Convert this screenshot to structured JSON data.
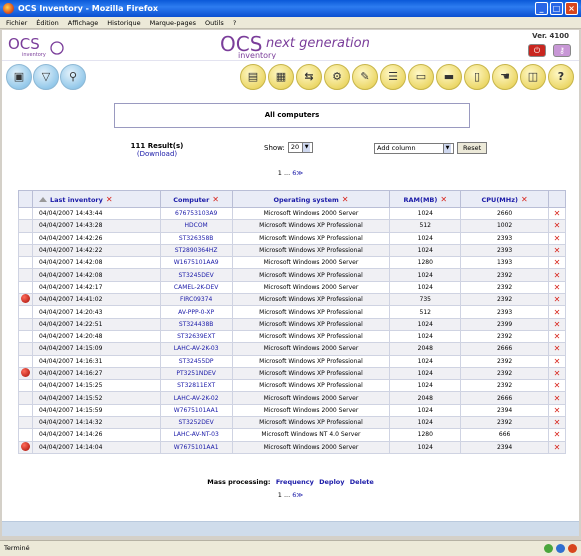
{
  "window": {
    "title": "OCS Inventory - Mozilla Firefox"
  },
  "menu": [
    "Fichier",
    "Édition",
    "Affichage",
    "Historique",
    "Marque-pages",
    "Outils",
    "?"
  ],
  "header": {
    "logo_small": "OCS",
    "logo_small_sub": "inventory",
    "logo_main_a": "OCS",
    "logo_main_b": "next generation",
    "logo_main_sub": "inventory",
    "version": "Ver. 4100"
  },
  "page": {
    "title": "All computers",
    "results": "111 Result(s)",
    "download": "(Download)",
    "show_label": "Show:",
    "show_value": "20",
    "add_column": "Add column",
    "reset": "Reset",
    "pager": {
      "prefix": "1 ... ",
      "page": "6",
      "next": "≫"
    },
    "mass_label": "Mass processing:",
    "mass_links": [
      "Frequency",
      "Deploy",
      "Delete"
    ]
  },
  "table": {
    "headers": [
      "Last inventory",
      "Computer",
      "Operating system",
      "RAM(MB)",
      "CPU(MHz)"
    ],
    "rows": [
      {
        "dot": false,
        "date": "04/04/2007 14:43:44",
        "computer": "676753103A9",
        "os": "Microsoft Windows 2000 Server",
        "ram": "1024",
        "cpu": "2660"
      },
      {
        "dot": false,
        "date": "04/04/2007 14:43:28",
        "computer": "HDCOM",
        "os": "Microsoft Windows XP Professional",
        "ram": "512",
        "cpu": "1002"
      },
      {
        "dot": false,
        "date": "04/04/2007 14:42:26",
        "computer": "ST326358B",
        "os": "Microsoft Windows XP Professional",
        "ram": "1024",
        "cpu": "2393"
      },
      {
        "dot": false,
        "date": "04/04/2007 14:42:22",
        "computer": "ST2890364HZ",
        "os": "Microsoft Windows XP Professional",
        "ram": "1024",
        "cpu": "2393"
      },
      {
        "dot": false,
        "date": "04/04/2007 14:42:08",
        "computer": "W1675101AA9",
        "os": "Microsoft Windows 2000 Server",
        "ram": "1280",
        "cpu": "1393"
      },
      {
        "dot": false,
        "date": "04/04/2007 14:42:08",
        "computer": "ST3245DEV",
        "os": "Microsoft Windows XP Professional",
        "ram": "1024",
        "cpu": "2392"
      },
      {
        "dot": false,
        "date": "04/04/2007 14:42:17",
        "computer": "CAMEL-2K-DEV",
        "os": "Microsoft Windows 2000 Server",
        "ram": "1024",
        "cpu": "2392"
      },
      {
        "dot": true,
        "date": "04/04/2007 14:41:02",
        "computer": "FIRC09374",
        "os": "Microsoft Windows XP Professional",
        "ram": "735",
        "cpu": "2392"
      },
      {
        "dot": false,
        "date": "04/04/2007 14:20:43",
        "computer": "AV-PPP-0-XP",
        "os": "Microsoft Windows XP Professional",
        "ram": "512",
        "cpu": "2393"
      },
      {
        "dot": false,
        "date": "04/04/2007 14:22:51",
        "computer": "ST324438B",
        "os": "Microsoft Windows XP Professional",
        "ram": "1024",
        "cpu": "2399"
      },
      {
        "dot": false,
        "date": "04/04/2007 14:20:48",
        "computer": "ST32639EXT",
        "os": "Microsoft Windows XP Professional",
        "ram": "1024",
        "cpu": "2392"
      },
      {
        "dot": false,
        "date": "04/04/2007 14:15:09",
        "computer": "LAHC-AV-2K-03",
        "os": "Microsoft Windows 2000 Server",
        "ram": "2048",
        "cpu": "2666"
      },
      {
        "dot": false,
        "date": "04/04/2007 14:16:31",
        "computer": "ST32455DP",
        "os": "Microsoft Windows XP Professional",
        "ram": "1024",
        "cpu": "2392"
      },
      {
        "dot": true,
        "date": "04/04/2007 14:16:27",
        "computer": "PT3251NDEV",
        "os": "Microsoft Windows XP Professional",
        "ram": "1024",
        "cpu": "2392"
      },
      {
        "dot": false,
        "date": "04/04/2007 14:15:25",
        "computer": "ST32811EXT",
        "os": "Microsoft Windows XP Professional",
        "ram": "1024",
        "cpu": "2392"
      },
      {
        "dot": false,
        "date": "04/04/2007 14:15:52",
        "computer": "LAHC-AV-2K-02",
        "os": "Microsoft Windows 2000 Server",
        "ram": "2048",
        "cpu": "2666"
      },
      {
        "dot": false,
        "date": "04/04/2007 14:15:59",
        "computer": "W7675101AA1",
        "os": "Microsoft Windows 2000 Server",
        "ram": "1024",
        "cpu": "2394"
      },
      {
        "dot": false,
        "date": "04/04/2007 14:14:32",
        "computer": "ST3252DEV",
        "os": "Microsoft Windows XP Professional",
        "ram": "1024",
        "cpu": "2392"
      },
      {
        "dot": false,
        "date": "04/04/2007 14:14:26",
        "computer": "LAHC-AV-NT-03",
        "os": "Microsoft Windows NT 4.0 Server",
        "ram": "1280",
        "cpu": "666"
      },
      {
        "dot": true,
        "date": "04/04/2007 14:14:04",
        "computer": "W7675101AA1",
        "os": "Microsoft Windows 2000 Server",
        "ram": "1024",
        "cpu": "2394"
      }
    ]
  },
  "status": {
    "text": "Terminé"
  }
}
